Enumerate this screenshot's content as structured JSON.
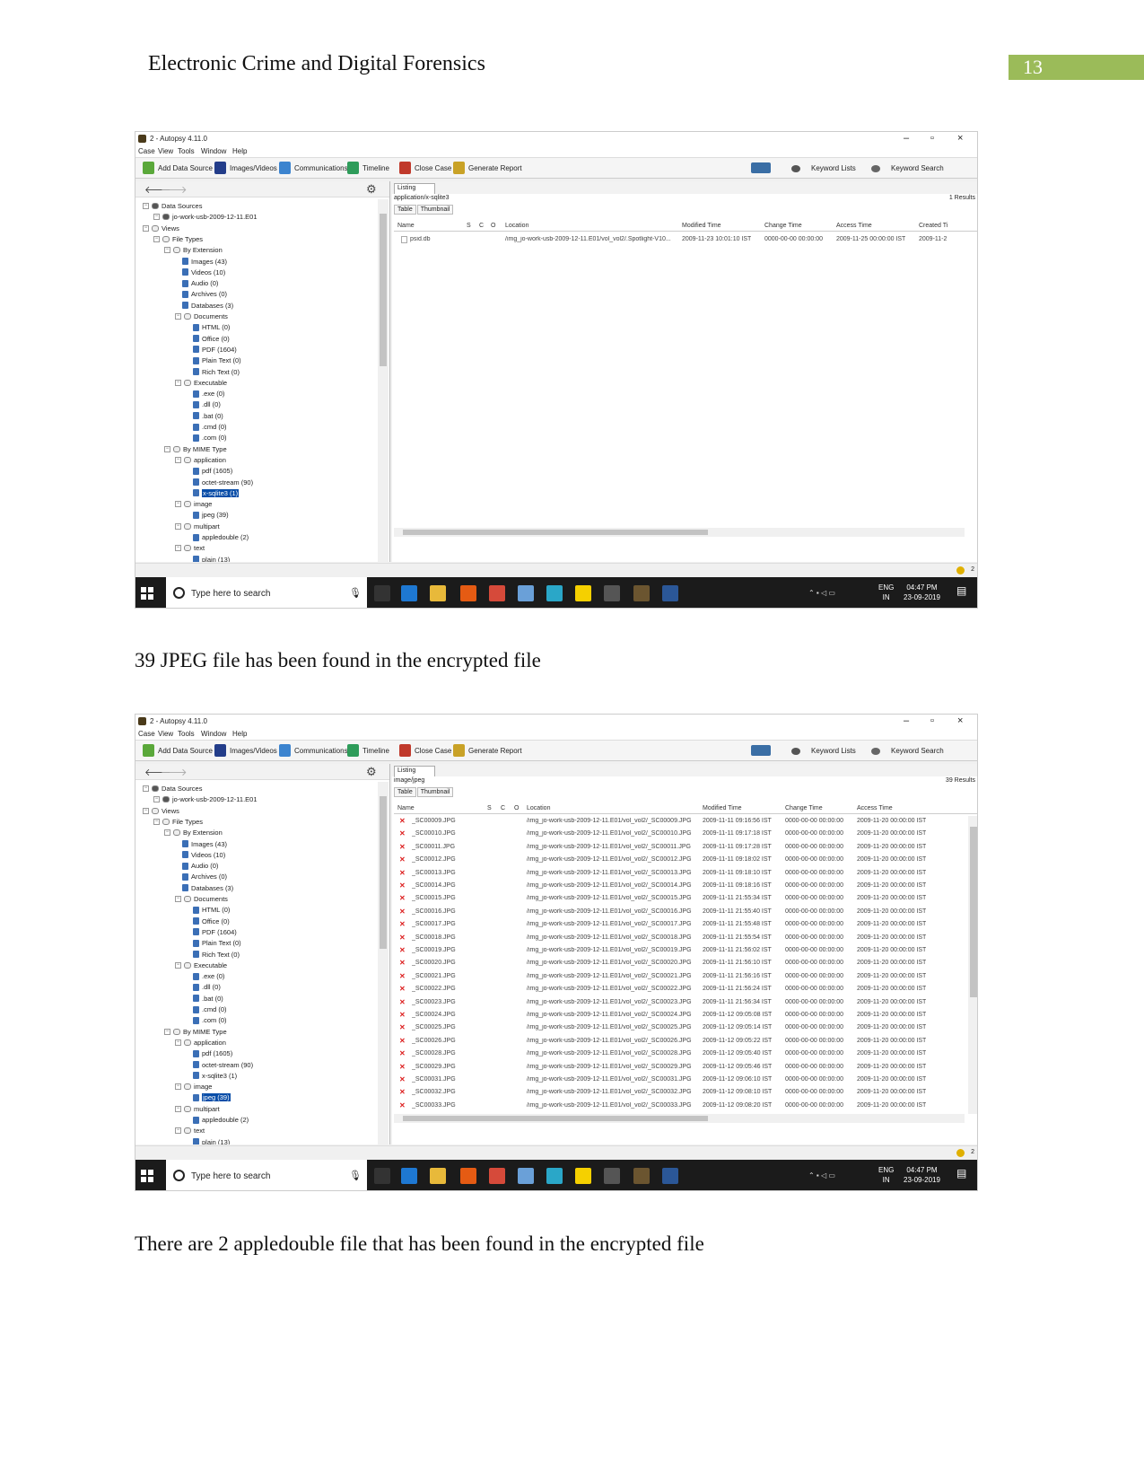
{
  "header": {
    "title": "Electronic Crime and Digital Forensics",
    "page_number": "13"
  },
  "captions": {
    "first": "39 JPEG file has been found in the encrypted file",
    "second": "There are 2 appledouble file that has been found in the encrypted file"
  },
  "app": {
    "title": "2 - Autopsy 4.11.0",
    "menu": [
      "Case",
      "View",
      "Tools",
      "Window",
      "Help"
    ],
    "toolbar": [
      "Add Data Source",
      "Images/Videos",
      "Communications",
      "Timeline",
      "Close Case",
      "Generate Report",
      "Keyword Lists",
      "Keyword Search"
    ],
    "tabs": {
      "listing": "Listing",
      "table": "Table",
      "thumbnail": "Thumbnail"
    },
    "status_count": "2"
  },
  "tree": {
    "data_sources": "Data Sources",
    "image": "jo-work-usb-2009-12-11.E01",
    "views": "Views",
    "file_types": "File Types",
    "by_extension": "By Extension",
    "images": "Images (43)",
    "videos": "Videos (10)",
    "audio": "Audio (0)",
    "archives": "Archives (0)",
    "databases": "Databases (3)",
    "documents": "Documents",
    "html": "HTML (0)",
    "office": "Office (0)",
    "pdf": "PDF (1604)",
    "plain_text": "Plain Text (0)",
    "rich_text": "Rich Text (0)",
    "executable": "Executable",
    "exe": ".exe (0)",
    "dll": ".dll (0)",
    "bat": ".bat (0)",
    "cmd": ".cmd (0)",
    "com": ".com (0)",
    "by_mime": "By MIME Type",
    "application": "application",
    "mime_pdf": "pdf (1605)",
    "octet": "octet-stream (90)",
    "sqlite": "x-sqlite3 (1)",
    "image_group": "image",
    "jpeg": "jpeg (39)",
    "multipart": "multipart",
    "appledouble": "appledouble (2)",
    "text": "text",
    "plain": "plain (13)"
  },
  "shot1": {
    "mime": "application/x-sqlite3",
    "results": "1 Results",
    "headers": [
      "Name",
      "S",
      "C",
      "O",
      "Location",
      "Modified Time",
      "Change Time",
      "Access Time",
      "Created Ti"
    ],
    "row": {
      "name": "psid.db",
      "location": "/img_jo-work-usb-2009-12-11.E01/vol_vol2/.Spotlight-V10...",
      "modified": "2009-11-23 10:01:10 IST",
      "change": "0000-00-00 00:00:00",
      "access": "2009-11-25 00:00:00 IST",
      "created": "2009-11-2"
    }
  },
  "shot2": {
    "mime": "image/jpeg",
    "results": "39 Results",
    "headers": [
      "Name",
      "S",
      "C",
      "O",
      "Location",
      "Modified Time",
      "Change Time",
      "Access Time"
    ],
    "location_prefix": "/img_jo-work-usb-2009-12-11.E01/vol_vol2/",
    "change": "0000-00-00 00:00:00",
    "access": "2009-11-20 00:00:00 IST",
    "rows": [
      {
        "name": "_SC00009.JPG",
        "modified": "2009-11-11 09:16:56 IST"
      },
      {
        "name": "_SC00010.JPG",
        "modified": "2009-11-11 09:17:18 IST"
      },
      {
        "name": "_SC00011.JPG",
        "modified": "2009-11-11 09:17:28 IST"
      },
      {
        "name": "_SC00012.JPG",
        "modified": "2009-11-11 09:18:02 IST"
      },
      {
        "name": "_SC00013.JPG",
        "modified": "2009-11-11 09:18:10 IST"
      },
      {
        "name": "_SC00014.JPG",
        "modified": "2009-11-11 09:18:16 IST"
      },
      {
        "name": "_SC00015.JPG",
        "modified": "2009-11-11 21:55:34 IST"
      },
      {
        "name": "_SC00016.JPG",
        "modified": "2009-11-11 21:55:40 IST"
      },
      {
        "name": "_SC00017.JPG",
        "modified": "2009-11-11 21:55:48 IST"
      },
      {
        "name": "_SC00018.JPG",
        "modified": "2009-11-11 21:55:54 IST"
      },
      {
        "name": "_SC00019.JPG",
        "modified": "2009-11-11 21:56:02 IST"
      },
      {
        "name": "_SC00020.JPG",
        "modified": "2009-11-11 21:56:10 IST"
      },
      {
        "name": "_SC00021.JPG",
        "modified": "2009-11-11 21:56:16 IST"
      },
      {
        "name": "_SC00022.JPG",
        "modified": "2009-11-11 21:56:24 IST"
      },
      {
        "name": "_SC00023.JPG",
        "modified": "2009-11-11 21:56:34 IST"
      },
      {
        "name": "_SC00024.JPG",
        "modified": "2009-11-12 09:05:08 IST"
      },
      {
        "name": "_SC00025.JPG",
        "modified": "2009-11-12 09:05:14 IST"
      },
      {
        "name": "_SC00026.JPG",
        "modified": "2009-11-12 09:05:22 IST"
      },
      {
        "name": "_SC00028.JPG",
        "modified": "2009-11-12 09:05:40 IST"
      },
      {
        "name": "_SC00029.JPG",
        "modified": "2009-11-12 09:05:46 IST"
      },
      {
        "name": "_SC00031.JPG",
        "modified": "2009-11-12 09:06:10 IST"
      },
      {
        "name": "_SC00032.JPG",
        "modified": "2009-11-12 09:08:10 IST"
      },
      {
        "name": "_SC00033.JPG",
        "modified": "2009-11-12 09:08:20 IST"
      }
    ]
  },
  "taskbar": {
    "search_placeholder": "Type here to search",
    "lang1": "ENG",
    "lang2": "IN",
    "time": "04:47 PM",
    "date": "23-09-2019"
  }
}
